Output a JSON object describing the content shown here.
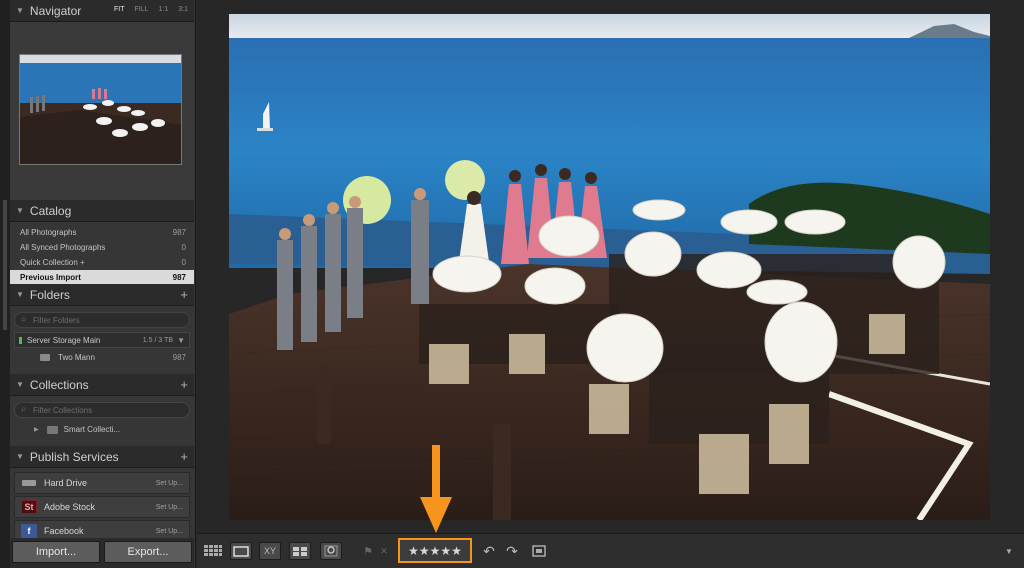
{
  "navigator": {
    "title": "Navigator",
    "zoom_options": [
      "FIT",
      "FILL",
      "1:1",
      "3:1"
    ],
    "active_zoom": "FIT"
  },
  "catalog": {
    "title": "Catalog",
    "items": [
      {
        "label": "All Photographs",
        "count": "987"
      },
      {
        "label": "All Synced Photographs",
        "count": "0"
      },
      {
        "label": "Quick Collection +",
        "count": "0"
      },
      {
        "label": "Previous Import",
        "count": "987",
        "selected": true
      }
    ]
  },
  "folders": {
    "title": "Folders",
    "filter_placeholder": "Filter Folders",
    "volume": {
      "name": "Server Storage Main",
      "capacity": "1.5 / 3 TB"
    },
    "items": [
      {
        "label": "Two Mann",
        "count": "987"
      }
    ]
  },
  "collections": {
    "title": "Collections",
    "filter_placeholder": "Filter Collections",
    "items": [
      {
        "label": "Smart Collecti..."
      }
    ]
  },
  "publish": {
    "title": "Publish Services",
    "services": [
      {
        "label": "Hard Drive",
        "action": "Set Up..."
      },
      {
        "label": "Adobe Stock",
        "icon_text": "St",
        "action": "Set Up..."
      },
      {
        "label": "Facebook",
        "icon_text": "f",
        "action": "Set Up..."
      }
    ]
  },
  "buttons": {
    "import": "Import...",
    "export": "Export..."
  },
  "toolbar": {
    "compare_label": "XY",
    "rating_stars": "★★★★★",
    "highlight_color": "#f7941d"
  }
}
